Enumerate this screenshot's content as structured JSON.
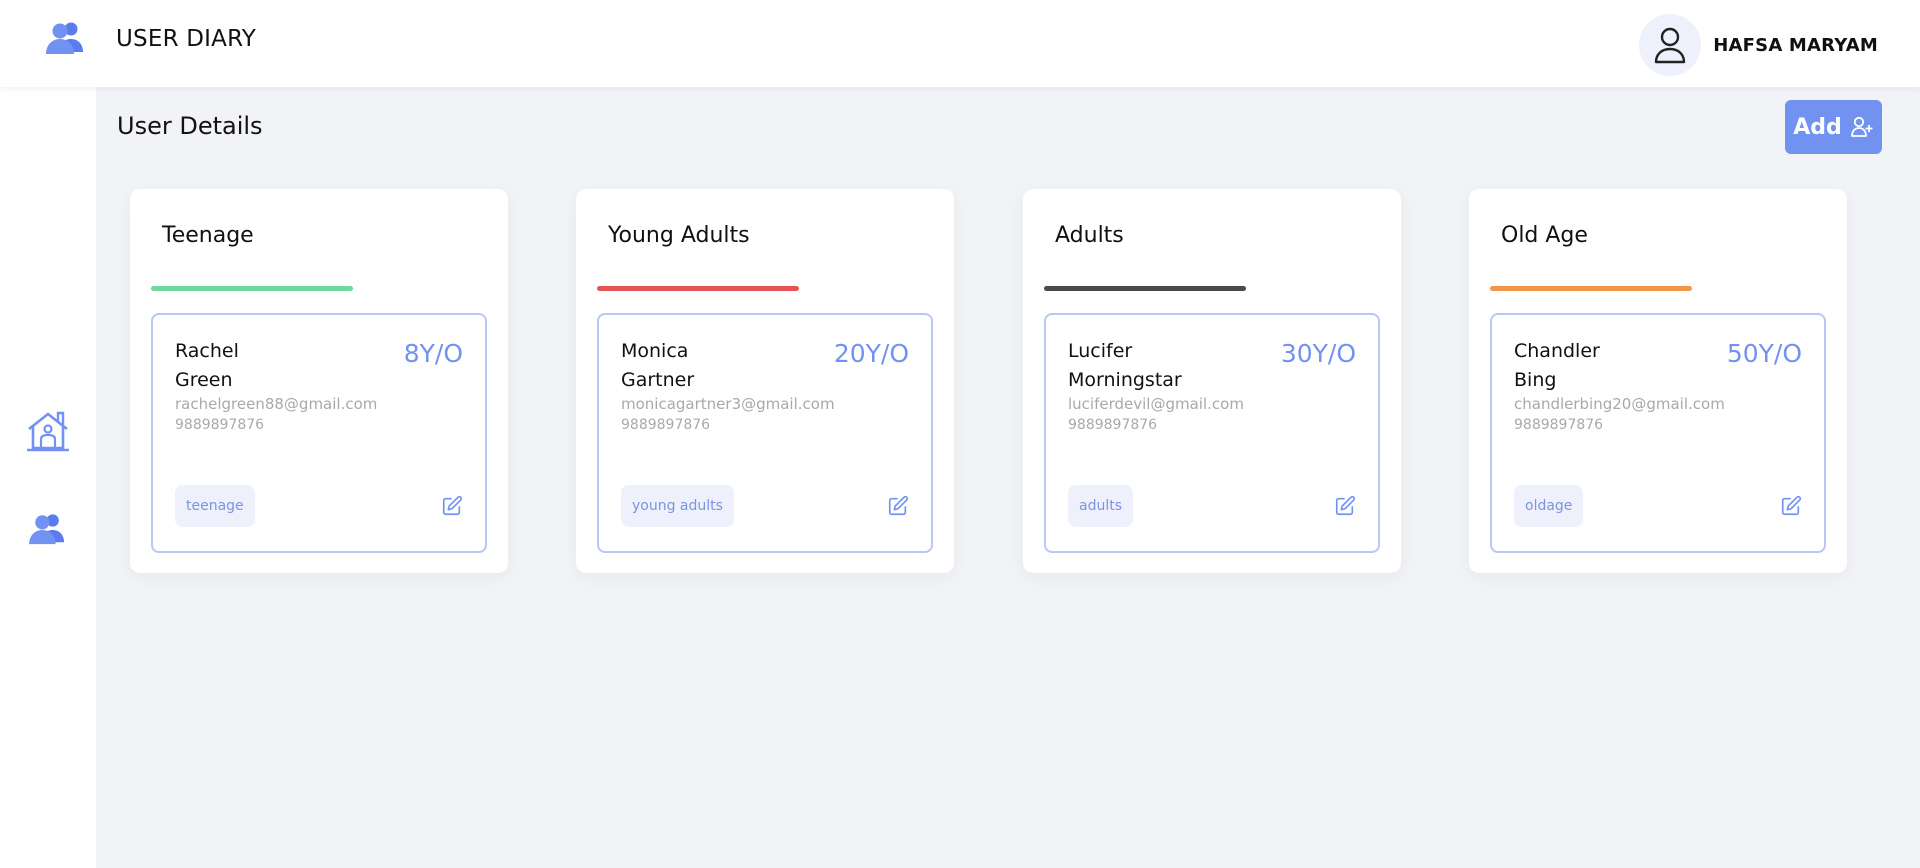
{
  "header": {
    "brand_icon": "users-icon",
    "title": "USER DIARY",
    "user_icon": "user-avatar-icon",
    "user_name": "HAFSA MARYAM"
  },
  "sidebar": {
    "items": [
      {
        "icon": "home-icon"
      },
      {
        "icon": "users-icon"
      }
    ]
  },
  "main": {
    "title": "User Details",
    "add_label": "Add",
    "add_icon": "add-user-icon"
  },
  "colors": {
    "accent": "#7292f2",
    "teenage": "#6ed99b",
    "young_adults": "#e55454",
    "adults": "#4a4a4a",
    "old_age": "#f0964a"
  },
  "categories": [
    {
      "title": "Teenage",
      "user": {
        "first": "Rachel",
        "last": "Green",
        "age": "8Y/O",
        "email": "rachelgreen88@gmail.com",
        "phone": "9889897876",
        "tag": "teenage"
      }
    },
    {
      "title": "Young Adults",
      "user": {
        "first": "Monica",
        "last": "Gartner",
        "age": "20Y/O",
        "email": "monicagartner3@gmail.com",
        "phone": "9889897876",
        "tag": "young adults"
      }
    },
    {
      "title": "Adults",
      "user": {
        "first": "Lucifer",
        "last": "Morningstar",
        "age": "30Y/O",
        "email": "luciferdevil@gmail.com",
        "phone": "9889897876",
        "tag": "adults"
      }
    },
    {
      "title": "Old Age",
      "user": {
        "first": "Chandler",
        "last": "Bing",
        "age": "50Y/O",
        "email": "chandlerbing20@gmail.com",
        "phone": "9889897876",
        "tag": "oldage"
      }
    }
  ]
}
